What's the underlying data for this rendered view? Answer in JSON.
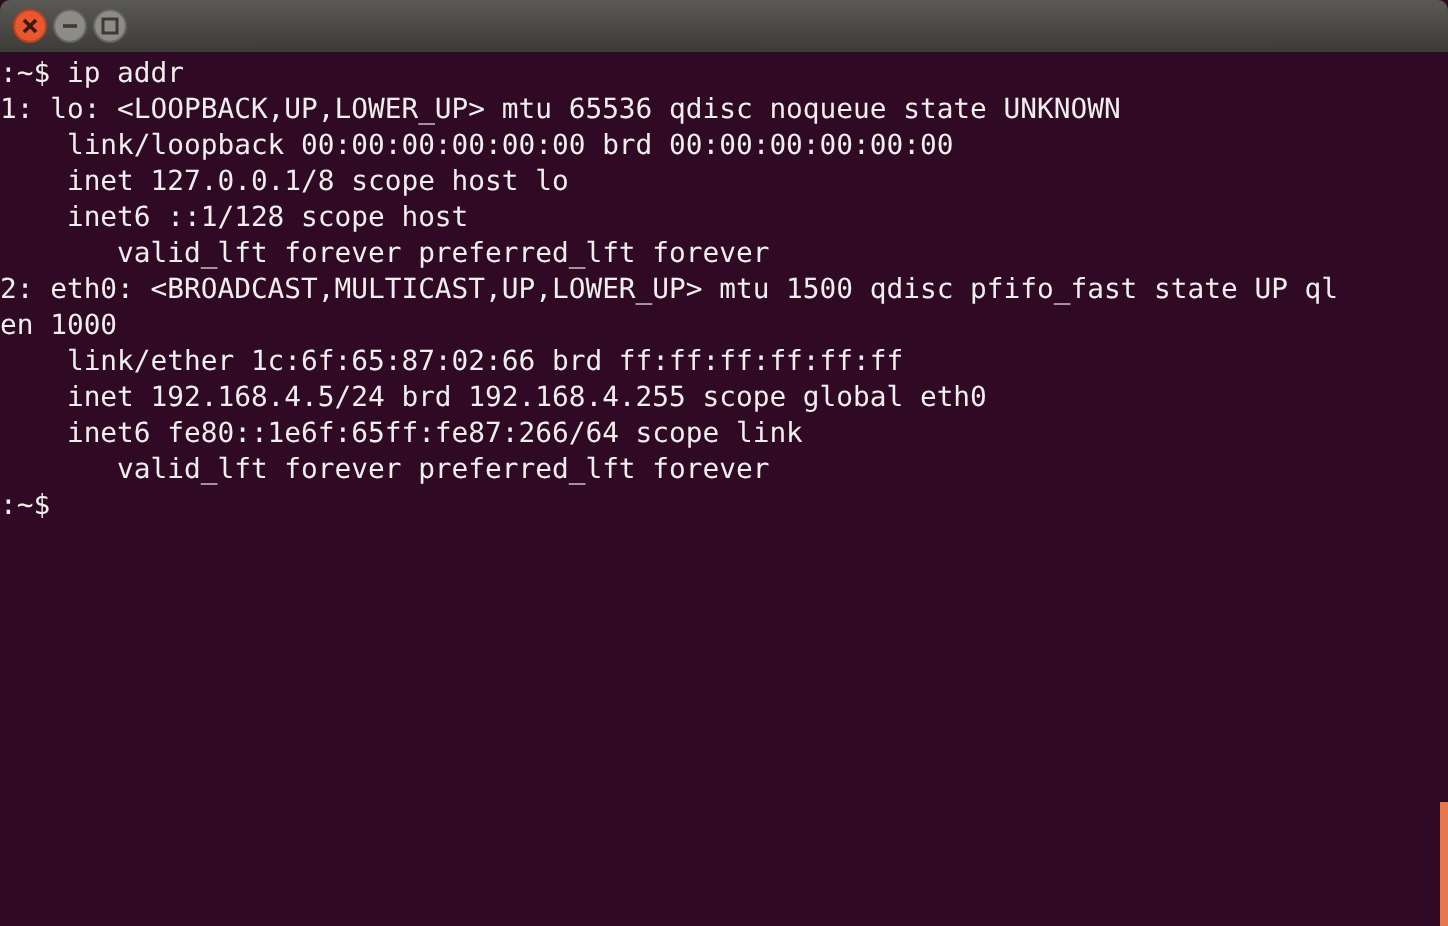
{
  "window": {
    "title_bar": {
      "buttons": [
        {
          "kind": "close"
        },
        {
          "kind": "minimize"
        },
        {
          "kind": "maximize"
        }
      ]
    }
  },
  "terminal": {
    "lines": [
      ":~$ ip addr",
      "1: lo: <LOOPBACK,UP,LOWER_UP> mtu 65536 qdisc noqueue state UNKNOWN",
      "    link/loopback 00:00:00:00:00:00 brd 00:00:00:00:00:00",
      "    inet 127.0.0.1/8 scope host lo",
      "    inet6 ::1/128 scope host",
      "       valid_lft forever preferred_lft forever",
      "2: eth0: <BROADCAST,MULTICAST,UP,LOWER_UP> mtu 1500 qdisc pfifo_fast state UP ql",
      "en 1000",
      "    link/ether 1c:6f:65:87:02:66 brd ff:ff:ff:ff:ff:ff",
      "    inet 192.168.4.5/24 brd 192.168.4.255 scope global eth0",
      "    inet6 fe80::1e6f:65ff:fe87:266/64 scope link",
      "       valid_lft forever preferred_lft forever",
      ":~$"
    ]
  }
}
